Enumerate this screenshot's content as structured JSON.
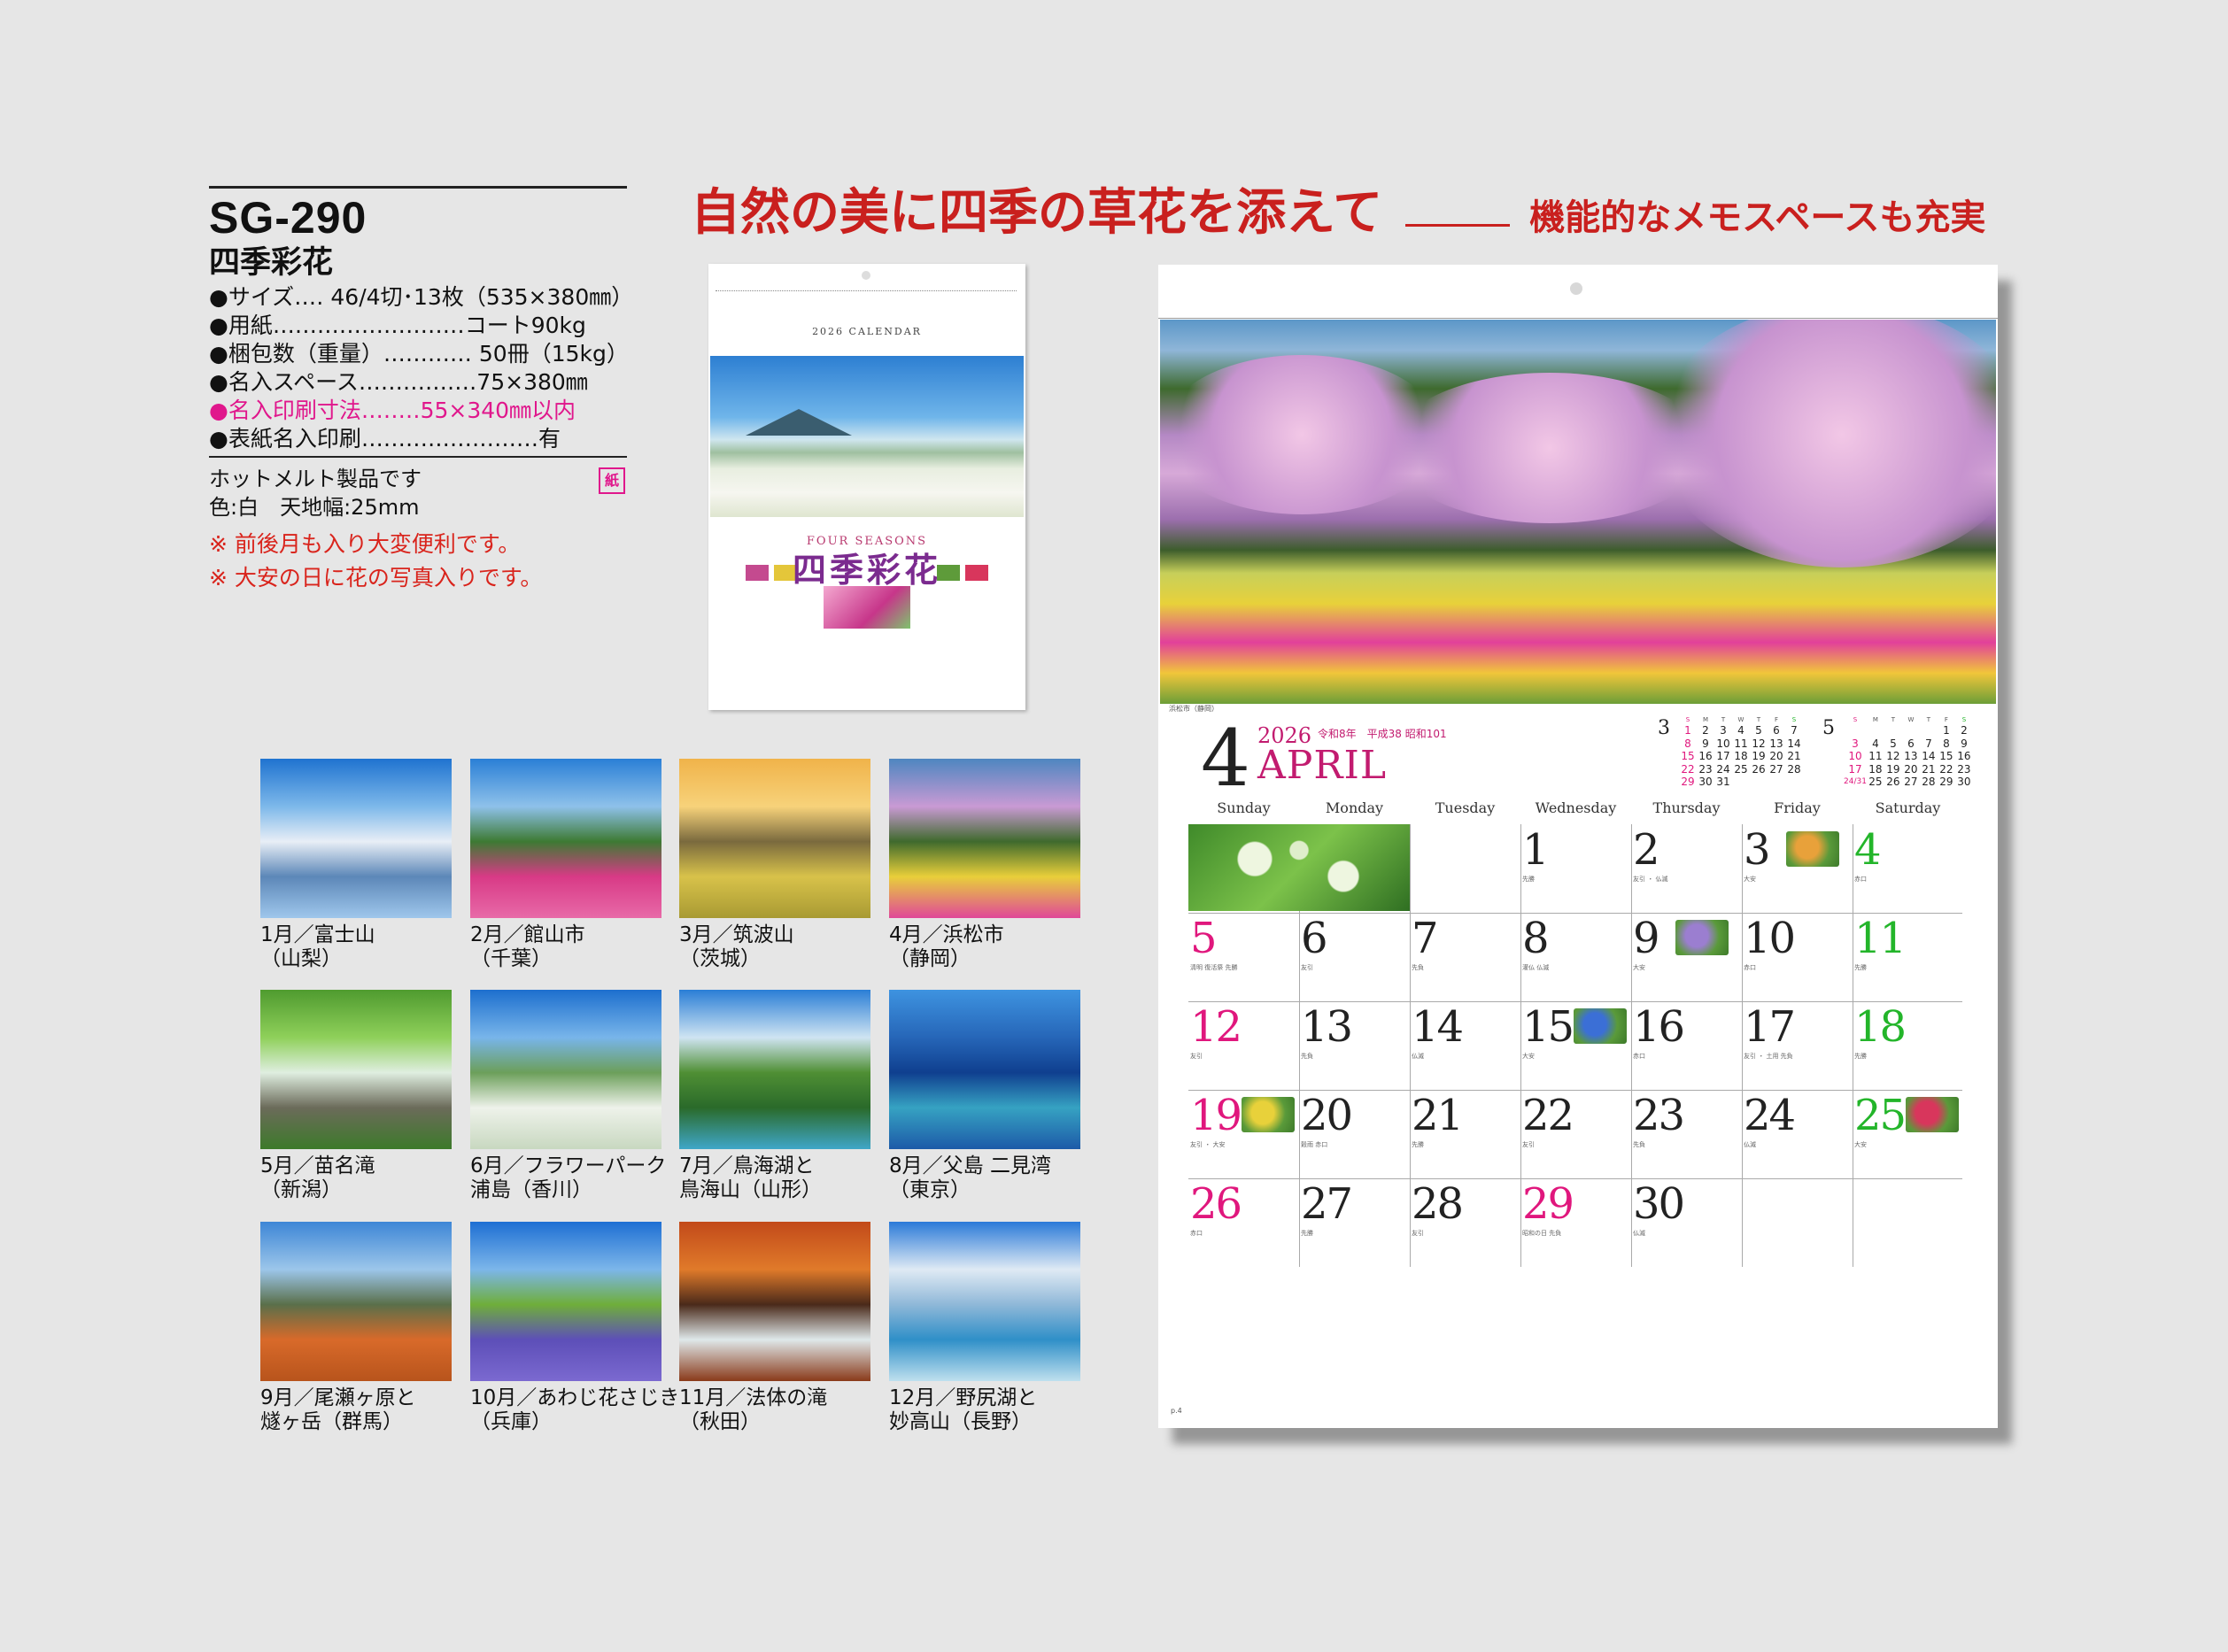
{
  "product": {
    "code": "SG-290",
    "name": "四季彩花",
    "specs": [
      "●サイズ‥‥ 46/4切･13枚（535×380㎜）",
      "●用紙‥‥‥‥‥‥‥‥‥‥‥‥‥コート90kg",
      "●梱包数（重量）‥‥‥‥‥‥ 50冊（15kg）",
      "●名入スペース‥‥‥‥‥‥‥‥75×380㎜",
      "●名入印刷寸法‥‥‥‥55×340㎜以内",
      "●表紙名入印刷‥‥‥‥‥‥‥‥‥‥‥‥有"
    ],
    "note1": "ホットメルト製品です",
    "paper_badge": "紙",
    "note2": "色:白　天地幅:25mm",
    "feature1": "※ 前後月も入り大変便利です。",
    "feature2": "※ 大安の日に花の写真入りです。"
  },
  "headline": {
    "main": "自然の美に四季の草花を添えて",
    "sub": "機能的なメモスペースも充実"
  },
  "cover": {
    "calendar_label": "2026 CALENDAR",
    "series_label": "FOUR SEASONS",
    "title": "四季彩花"
  },
  "thumbnails": [
    {
      "caption": "1月／富士山\n（山梨）",
      "colors": [
        "#1f73d0",
        "#7db8ea",
        "#e8eef6",
        "#5c87b8",
        "#9fc7ec"
      ]
    },
    {
      "caption": "2月／館山市\n（千葉）",
      "colors": [
        "#2a7fd6",
        "#8ec1ea",
        "#3d7a33",
        "#d83a86",
        "#e86aa8"
      ]
    },
    {
      "caption": "3月／筑波山\n（茨城）",
      "colors": [
        "#f0b34a",
        "#f7d27a",
        "#7a6a3e",
        "#d8c24a",
        "#a89a33"
      ]
    },
    {
      "caption": "4月／浜松市\n（静岡）",
      "colors": [
        "#4e86c0",
        "#c99ad4",
        "#3f6a2d",
        "#e8cf3a",
        "#e04899"
      ]
    },
    {
      "caption": "5月／苗名滝\n（新潟）",
      "colors": [
        "#4f9b2f",
        "#8fd05a",
        "#dfeee0",
        "#6b6b5a",
        "#3d7a2a"
      ]
    },
    {
      "caption": "6月／フラワーパーク\n浦島（香川）",
      "colors": [
        "#1d6fce",
        "#78b5ea",
        "#6c9f5a",
        "#eef2ea",
        "#c8d8c0"
      ]
    },
    {
      "caption": "7月／鳥海湖と\n鳥海山（山形）",
      "colors": [
        "#2a7ed6",
        "#cfe4f2",
        "#4f8f34",
        "#2a6a2a",
        "#3fa6c8"
      ]
    },
    {
      "caption": "8月／父島 二見湾\n（東京）",
      "colors": [
        "#3e93e0",
        "#2666b8",
        "#0f3f8f",
        "#36a2c2",
        "#1d5aa8"
      ]
    },
    {
      "caption": "9月／尾瀬ヶ原と\n燧ヶ岳（群馬）",
      "colors": [
        "#3d86d6",
        "#9cc6ea",
        "#5a6f4a",
        "#d86a2a",
        "#b8541c"
      ]
    },
    {
      "caption": "10月／あわじ花さじき\n（兵庫）",
      "colors": [
        "#1e6fd3",
        "#7cb6ea",
        "#6fae3a",
        "#5d4fb8",
        "#7b69d0"
      ]
    },
    {
      "caption": "11月／法体の滝\n（秋田）",
      "colors": [
        "#c24a1a",
        "#e07a2a",
        "#4a2a1a",
        "#dfe8ea",
        "#8a3a1a"
      ]
    },
    {
      "caption": "12月／野尻湖と\n妙高山（長野）",
      "colors": [
        "#2b7ad8",
        "#dfeaf4",
        "#8fb8d8",
        "#2f8fc8",
        "#bfe0ee"
      ]
    }
  ],
  "calendar": {
    "photo_credit": "浜松市（静岡）",
    "month_num": "4",
    "year": "2026",
    "era": "令和8年　平成38 昭和101",
    "month_name": "APRIL",
    "weekdays": [
      "Sunday",
      "Monday",
      "Tuesday",
      "Wednesday",
      "Thursday",
      "Friday",
      "Saturday"
    ],
    "prev_month": {
      "label": "3",
      "header": [
        "S",
        "M",
        "T",
        "W",
        "T",
        "F",
        "S"
      ],
      "rows": [
        [
          "1",
          "2",
          "3",
          "4",
          "5",
          "6",
          "7"
        ],
        [
          "8",
          "9",
          "10",
          "11",
          "12",
          "13",
          "14"
        ],
        [
          "15",
          "16",
          "17",
          "18",
          "19",
          "20",
          "21"
        ],
        [
          "22",
          "23",
          "24",
          "25",
          "26",
          "27",
          "28"
        ],
        [
          "29",
          "30",
          "31",
          "",
          "",
          "",
          ""
        ]
      ]
    },
    "next_month": {
      "label": "5",
      "header": [
        "S",
        "M",
        "T",
        "W",
        "T",
        "F",
        "S"
      ],
      "rows": [
        [
          "",
          "",
          "",
          "",
          "",
          "1",
          "2"
        ],
        [
          "3",
          "4",
          "5",
          "6",
          "7",
          "8",
          "9"
        ],
        [
          "10",
          "11",
          "12",
          "13",
          "14",
          "15",
          "16"
        ],
        [
          "17",
          "18",
          "19",
          "20",
          "21",
          "22",
          "23"
        ],
        [
          "24/31",
          "25",
          "26",
          "27",
          "28",
          "29",
          "30"
        ]
      ]
    },
    "days": [
      {
        "n": "1",
        "col": 3,
        "row": 0,
        "color": "#222",
        "sub": "先勝"
      },
      {
        "n": "2",
        "col": 4,
        "row": 0,
        "color": "#222",
        "sub": "友引 ・ 仏滅"
      },
      {
        "n": "3",
        "col": 5,
        "row": 0,
        "color": "#222",
        "sub": "大安",
        "flower": "#e8a13a"
      },
      {
        "n": "4",
        "col": 6,
        "row": 0,
        "color": "#23b52a",
        "sub": "赤口"
      },
      {
        "n": "5",
        "col": 0,
        "row": 1,
        "color": "#e0177d",
        "sub": "清明 復活祭 先勝"
      },
      {
        "n": "6",
        "col": 1,
        "row": 1,
        "color": "#222",
        "sub": "友引"
      },
      {
        "n": "7",
        "col": 2,
        "row": 1,
        "color": "#222",
        "sub": "先負"
      },
      {
        "n": "8",
        "col": 3,
        "row": 1,
        "color": "#222",
        "sub": "灌仏 仏滅"
      },
      {
        "n": "9",
        "col": 4,
        "row": 1,
        "color": "#222",
        "sub": "大安",
        "flower": "#9b7ed0"
      },
      {
        "n": "10",
        "col": 5,
        "row": 1,
        "color": "#222",
        "sub": "赤口"
      },
      {
        "n": "11",
        "col": 6,
        "row": 1,
        "color": "#23b52a",
        "sub": "先勝"
      },
      {
        "n": "12",
        "col": 0,
        "row": 2,
        "color": "#e0177d",
        "sub": "友引"
      },
      {
        "n": "13",
        "col": 1,
        "row": 2,
        "color": "#222",
        "sub": "先負"
      },
      {
        "n": "14",
        "col": 2,
        "row": 2,
        "color": "#222",
        "sub": "仏滅"
      },
      {
        "n": "15",
        "col": 3,
        "row": 2,
        "color": "#222",
        "sub": "大安",
        "flower": "#3b6fd6"
      },
      {
        "n": "16",
        "col": 4,
        "row": 2,
        "color": "#222",
        "sub": "赤口"
      },
      {
        "n": "17",
        "col": 5,
        "row": 2,
        "color": "#222",
        "sub": "友引 ・ 土用 先負"
      },
      {
        "n": "18",
        "col": 6,
        "row": 2,
        "color": "#23b52a",
        "sub": "先勝"
      },
      {
        "n": "19",
        "col": 0,
        "row": 3,
        "color": "#e0177d",
        "sub": "友引 ・ 大安",
        "flower": "#e8d13a"
      },
      {
        "n": "20",
        "col": 1,
        "row": 3,
        "color": "#222",
        "sub": "穀雨 赤口"
      },
      {
        "n": "21",
        "col": 2,
        "row": 3,
        "color": "#222",
        "sub": "先勝"
      },
      {
        "n": "22",
        "col": 3,
        "row": 3,
        "color": "#222",
        "sub": "友引"
      },
      {
        "n": "23",
        "col": 4,
        "row": 3,
        "color": "#222",
        "sub": "先負"
      },
      {
        "n": "24",
        "col": 5,
        "row": 3,
        "color": "#222",
        "sub": "仏滅"
      },
      {
        "n": "25",
        "col": 6,
        "row": 3,
        "color": "#23b52a",
        "sub": "大安",
        "flower": "#d8365c"
      },
      {
        "n": "26",
        "col": 0,
        "row": 4,
        "color": "#e0177d",
        "sub": "赤口"
      },
      {
        "n": "27",
        "col": 1,
        "row": 4,
        "color": "#222",
        "sub": "先勝"
      },
      {
        "n": "28",
        "col": 2,
        "row": 4,
        "color": "#222",
        "sub": "友引"
      },
      {
        "n": "29",
        "col": 3,
        "row": 4,
        "color": "#e0177d",
        "sub": "昭和の日 先負"
      },
      {
        "n": "30",
        "col": 4,
        "row": 4,
        "color": "#222",
        "sub": "仏滅"
      }
    ],
    "page_number": "p.4"
  },
  "colors": {
    "headline_red": "#c9201e",
    "accent_pink": "#e0178c",
    "sunday_pink": "#e0177d",
    "saturday_green": "#23b52a"
  }
}
